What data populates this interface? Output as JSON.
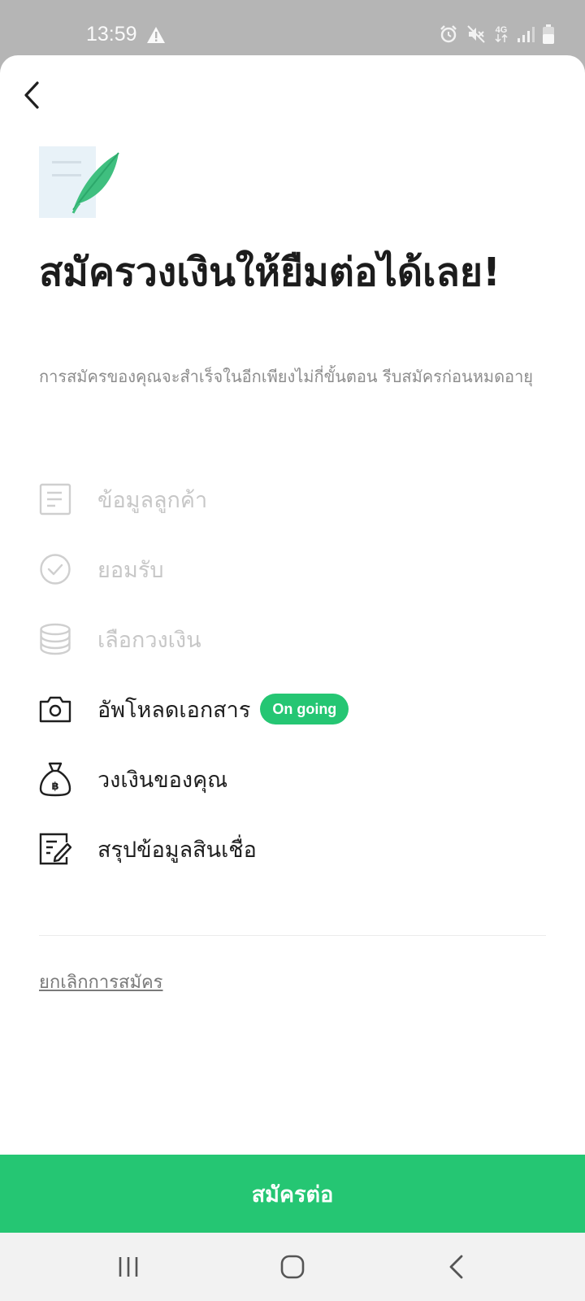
{
  "status_bar": {
    "time": "13:59",
    "network": "4G",
    "icons": [
      "warning-icon",
      "alarm-icon",
      "mute-icon",
      "network-4g-icon",
      "signal-icon",
      "battery-icon"
    ]
  },
  "header": {
    "back_icon": "chevron-left-icon",
    "illustration_icon": "document-feather-icon"
  },
  "main": {
    "title": "สมัครวงเงินให้ยืมต่อได้เลย!",
    "subtitle": "การสมัครของคุณจะสำเร็จในอีกเพียงไม่กี่ขั้นตอน รีบสมัครก่อนหมดอายุ",
    "steps": [
      {
        "label": "ข้อมูลลูกค้า",
        "icon": "document-icon",
        "state": "done"
      },
      {
        "label": "ยอมรับ",
        "icon": "check-circle-icon",
        "state": "done"
      },
      {
        "label": "เลือกวงเงิน",
        "icon": "coins-stack-icon",
        "state": "done"
      },
      {
        "label": "อัพโหลดเอกสาร",
        "icon": "camera-icon",
        "state": "active",
        "badge": "On going"
      },
      {
        "label": "วงเงินของคุณ",
        "icon": "money-bag-icon",
        "state": "todo"
      },
      {
        "label": "สรุปข้อมูลสินเชื่อ",
        "icon": "edit-document-icon",
        "state": "todo"
      }
    ],
    "cancel_label": "ยกเลิกการสมัคร",
    "continue_label": "สมัครต่อ"
  },
  "colors": {
    "accent": "#25c673",
    "done_text": "#c7c7c7",
    "status_bar": "#b5b5b5"
  },
  "nav_bar": {
    "icons": [
      "recent-apps-icon",
      "home-icon",
      "back-icon"
    ]
  }
}
